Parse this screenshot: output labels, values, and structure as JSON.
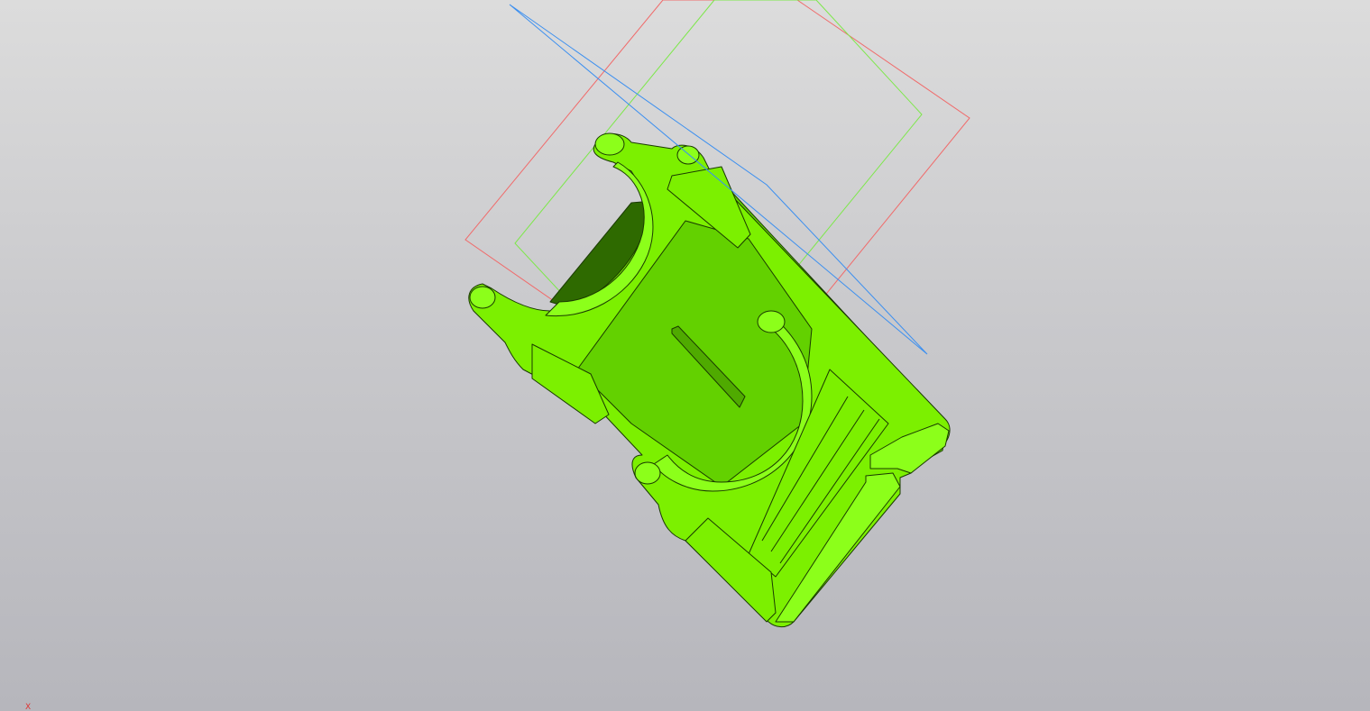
{
  "viewport": {
    "background_top": "#dcdcdc",
    "background_bottom": "#b6b6bc"
  },
  "model": {
    "part_color": "#7cf000",
    "part_shadow_color": "#63d100",
    "edge_color": "#1a3a00"
  },
  "planes": {
    "front_plane_color": "#f06b6b",
    "top_plane_color": "#7de84a",
    "right_plane_color": "#3b8ff0"
  },
  "axis_triad": {
    "x_label": "X",
    "x_color": "#dd3333"
  }
}
